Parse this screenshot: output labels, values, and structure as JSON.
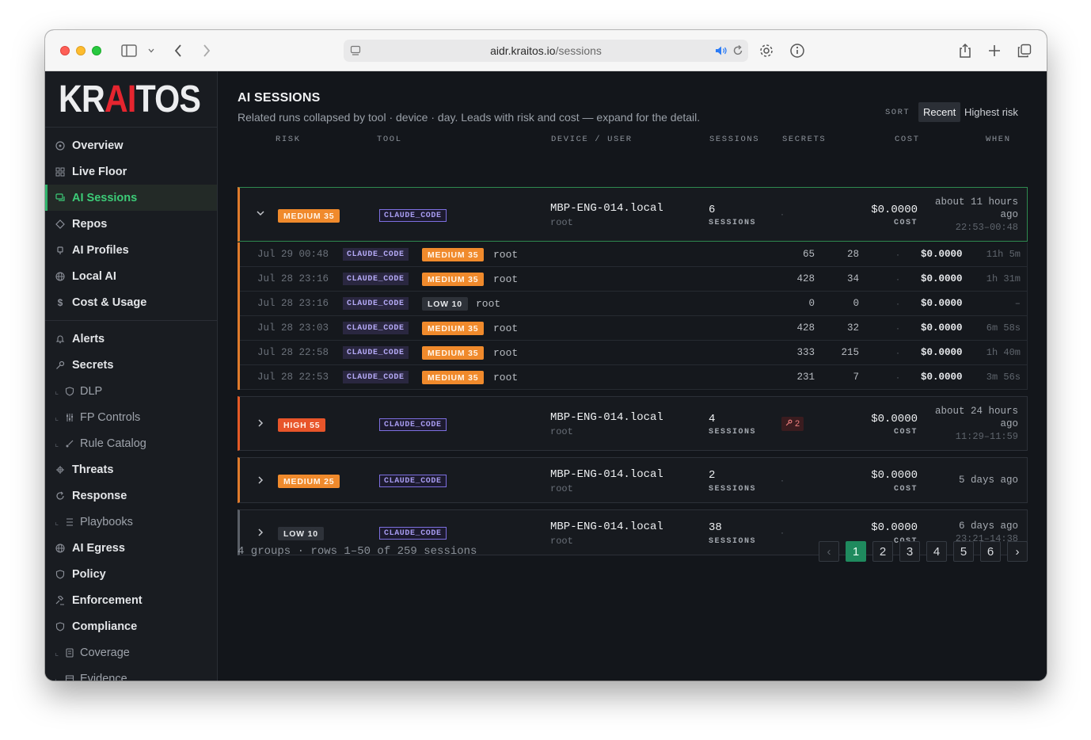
{
  "browser": {
    "host": "aidr.kraitos.io",
    "path": "/sessions"
  },
  "logo": {
    "pre": "KR",
    "ai": "AI",
    "post": "TOS"
  },
  "sidebar": {
    "items": [
      {
        "label": "Overview",
        "icon": "gauge-icon"
      },
      {
        "label": "Live Floor",
        "icon": "grid-icon"
      },
      {
        "label": "AI Sessions",
        "icon": "chat-icon"
      },
      {
        "label": "Repos",
        "icon": "diamond-icon"
      },
      {
        "label": "AI Profiles",
        "icon": "chip-icon"
      },
      {
        "label": "Local AI",
        "icon": "globe-icon"
      },
      {
        "label": "Cost & Usage",
        "icon": "dollar-icon"
      },
      {
        "label": "Alerts",
        "icon": "bell-icon"
      },
      {
        "label": "Secrets",
        "icon": "key-icon"
      },
      {
        "label": "DLP",
        "icon": "shield-icon"
      },
      {
        "label": "FP Controls",
        "icon": "sliders-icon"
      },
      {
        "label": "Rule Catalog",
        "icon": "rules-icon"
      },
      {
        "label": "Threats",
        "icon": "bug-icon"
      },
      {
        "label": "Response",
        "icon": "refresh-icon"
      },
      {
        "label": "Playbooks",
        "icon": "playbook-icon"
      },
      {
        "label": "AI Egress",
        "icon": "globe-icon"
      },
      {
        "label": "Policy",
        "icon": "shield-icon"
      },
      {
        "label": "Enforcement",
        "icon": "gavel-icon"
      },
      {
        "label": "Compliance",
        "icon": "shield-icon"
      },
      {
        "label": "Coverage",
        "icon": "doc-icon"
      },
      {
        "label": "Evidence",
        "icon": "archive-icon"
      }
    ]
  },
  "header": {
    "title": "AI SESSIONS",
    "subtitle": "Related runs collapsed by tool · device · day. Leads with risk and cost — expand for the detail.",
    "sort_label": "SORT",
    "sort_recent": "Recent",
    "sort_risk": "Highest risk"
  },
  "columns": {
    "risk": "RISK",
    "tool": "TOOL",
    "device": "DEVICE / USER",
    "sessions": "SESSIONS",
    "secrets": "SECRETS",
    "cost": "COST",
    "when": "WHEN"
  },
  "groups": [
    {
      "risk": "MEDIUM 35",
      "tool": "CLAUDE_CODE",
      "device": "MBP-ENG-014.local",
      "user": "root",
      "sessions": "6",
      "sessions_label": "SESSIONS",
      "secrets": "·",
      "cost": "$0.0000",
      "cost_label": "COST",
      "when1": "about 11 hours",
      "when2": "ago",
      "range": "22:53–00:48"
    },
    {
      "risk": "HIGH 55",
      "tool": "CLAUDE_CODE",
      "device": "MBP-ENG-014.local",
      "user": "root",
      "sessions": "4",
      "sessions_label": "SESSIONS",
      "secrets": "2",
      "cost": "$0.0000",
      "cost_label": "COST",
      "when1": "about 24 hours",
      "when2": "ago",
      "range": "11:29–11:59"
    },
    {
      "risk": "MEDIUM 25",
      "tool": "CLAUDE_CODE",
      "device": "MBP-ENG-014.local",
      "user": "root",
      "sessions": "2",
      "sessions_label": "SESSIONS",
      "secrets": "·",
      "cost": "$0.0000",
      "cost_label": "COST",
      "when1": "5 days ago"
    },
    {
      "risk": "LOW 10",
      "tool": "CLAUDE_CODE",
      "device": "MBP-ENG-014.local",
      "user": "root",
      "sessions": "38",
      "sessions_label": "SESSIONS",
      "secrets": "·",
      "cost": "$0.0000",
      "cost_label": "COST",
      "when1": "6 days ago",
      "range": "23:21–14:38"
    }
  ],
  "rows": [
    {
      "date": "Jul 29 00:48",
      "tool": "CLAUDE_CODE",
      "risk": "MEDIUM 35",
      "user": "root",
      "a": "65",
      "b": "28",
      "secrets": "·",
      "cost": "$0.0000",
      "dur": "11h 5m"
    },
    {
      "date": "Jul 28 23:16",
      "tool": "CLAUDE_CODE",
      "risk": "MEDIUM 35",
      "user": "root",
      "a": "428",
      "b": "34",
      "secrets": "·",
      "cost": "$0.0000",
      "dur": "1h 31m"
    },
    {
      "date": "Jul 28 23:16",
      "tool": "CLAUDE_CODE",
      "risk": "LOW 10",
      "user": "root",
      "a": "0",
      "b": "0",
      "secrets": "·",
      "cost": "$0.0000",
      "dur": "–"
    },
    {
      "date": "Jul 28 23:03",
      "tool": "CLAUDE_CODE",
      "risk": "MEDIUM 35",
      "user": "root",
      "a": "428",
      "b": "32",
      "secrets": "·",
      "cost": "$0.0000",
      "dur": "6m 58s"
    },
    {
      "date": "Jul 28 22:58",
      "tool": "CLAUDE_CODE",
      "risk": "MEDIUM 35",
      "user": "root",
      "a": "333",
      "b": "215",
      "secrets": "·",
      "cost": "$0.0000",
      "dur": "1h 40m"
    },
    {
      "date": "Jul 28 22:53",
      "tool": "CLAUDE_CODE",
      "risk": "MEDIUM 35",
      "user": "root",
      "a": "231",
      "b": "7",
      "secrets": "·",
      "cost": "$0.0000",
      "dur": "3m 56s"
    }
  ],
  "footer": {
    "summary": "4 groups · rows 1–50 of 259 sessions",
    "pages": [
      "1",
      "2",
      "3",
      "4",
      "5",
      "6"
    ],
    "prev": "‹",
    "next": "›"
  }
}
